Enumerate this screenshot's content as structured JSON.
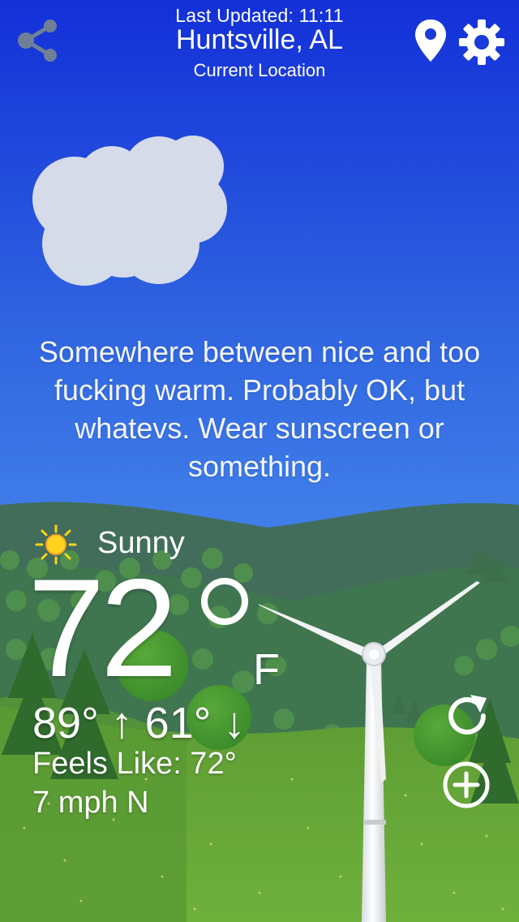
{
  "header": {
    "last_updated": "Last Updated: 11:11",
    "city": "Huntsville, AL",
    "location_label": "Current Location"
  },
  "icons": {
    "share": "share-icon",
    "location": "location-pin-icon",
    "settings": "gear-icon",
    "condition": "sun-icon",
    "refresh": "refresh-icon",
    "add": "add-circle-icon"
  },
  "quip": "Somewhere between nice and too fucking warm. Probably OK, but whatevs. Wear sunscreen or something.",
  "weather": {
    "condition": "Sunny",
    "temperature": "72",
    "unit": "F",
    "high_low": "89° ↑ 61° ↓",
    "feels_like": "Feels Like: 72°",
    "wind": "7 mph N"
  },
  "colors": {
    "sky_top": "#1733d6",
    "sky_bottom": "#5aa4f5",
    "hills_far": "#3f6b58",
    "grass": "#66a336",
    "sun": "#ffd21f"
  }
}
